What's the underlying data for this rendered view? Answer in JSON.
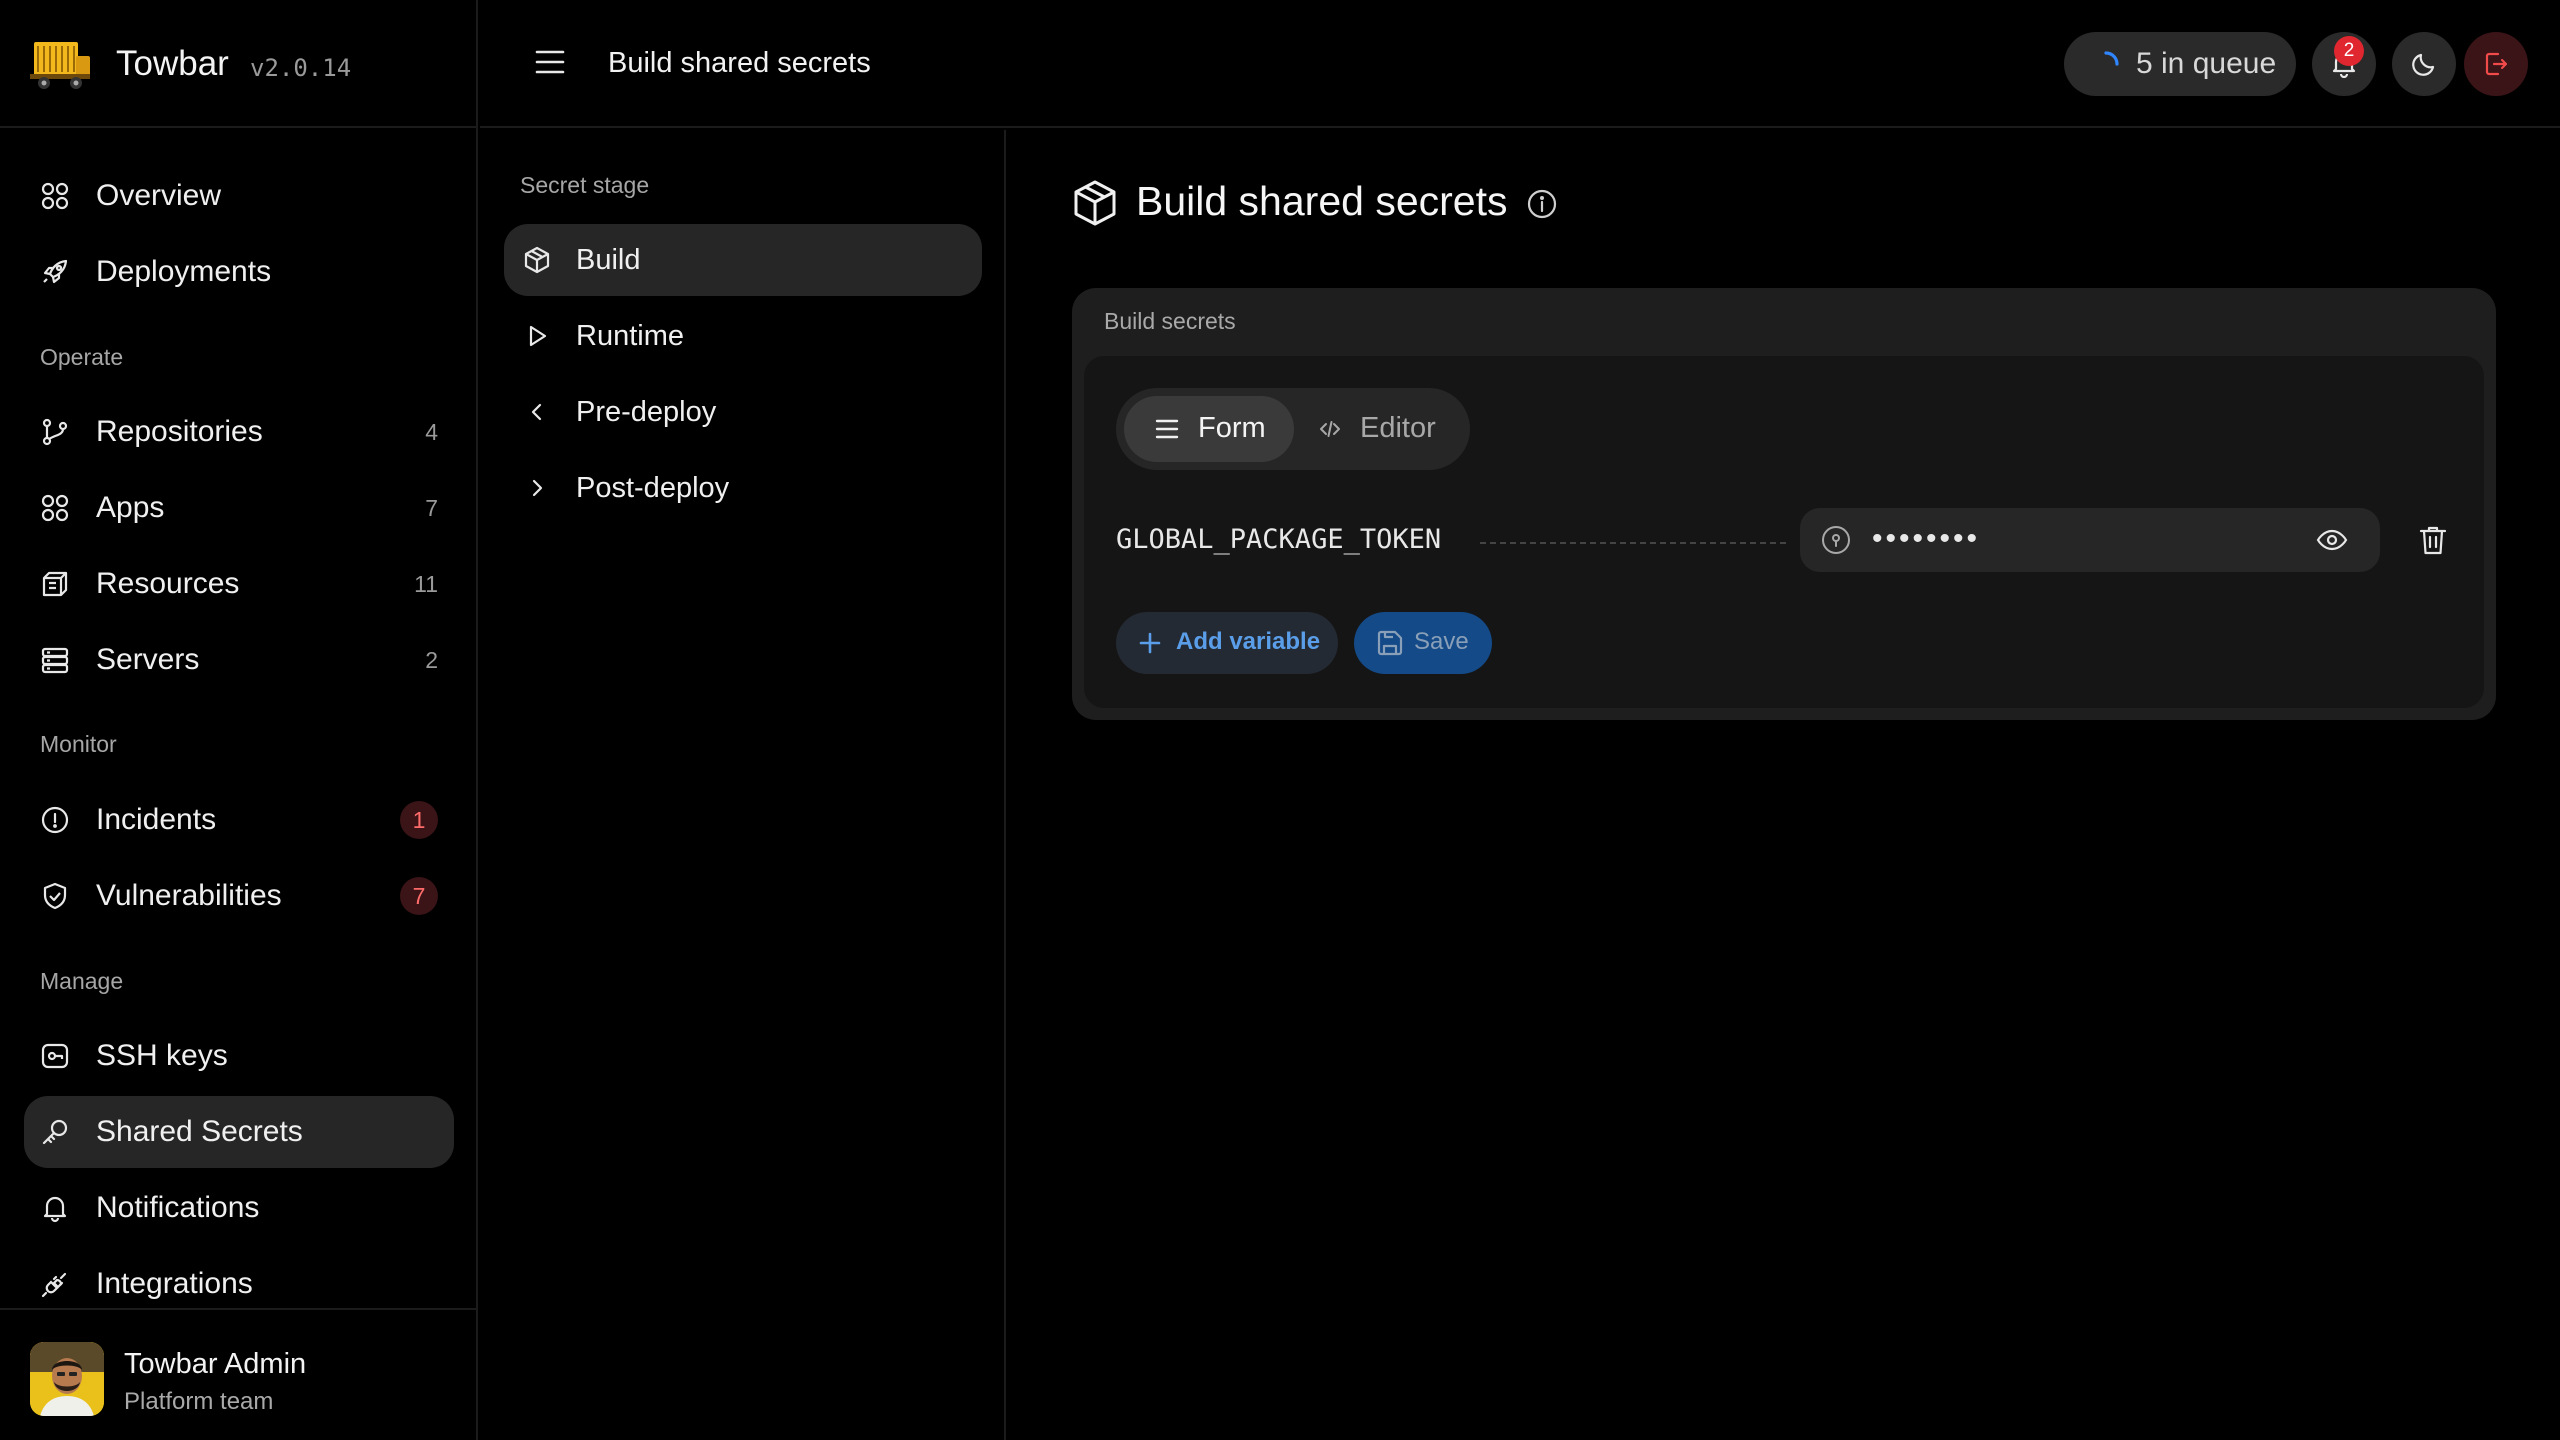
{
  "app": {
    "name": "Towbar",
    "version": "v2.0.14"
  },
  "sidebar": {
    "primary": [
      {
        "label": "Overview",
        "icon": "grid-icon"
      },
      {
        "label": "Deployments",
        "icon": "rocket-icon"
      }
    ],
    "sections": [
      {
        "title": "Operate",
        "items": [
          {
            "label": "Repositories",
            "count": "4",
            "icon": "git-branch-icon"
          },
          {
            "label": "Apps",
            "count": "7",
            "icon": "grid-icon"
          },
          {
            "label": "Resources",
            "count": "11",
            "icon": "database-icon"
          },
          {
            "label": "Servers",
            "count": "2",
            "icon": "server-icon"
          }
        ]
      },
      {
        "title": "Monitor",
        "items": [
          {
            "label": "Incidents",
            "badge": "1",
            "icon": "alert-circle-icon"
          },
          {
            "label": "Vulnerabilities",
            "badge": "7",
            "icon": "shield-check-icon"
          }
        ]
      },
      {
        "title": "Manage",
        "items": [
          {
            "label": "SSH keys",
            "icon": "terminal-icon"
          },
          {
            "label": "Shared Secrets",
            "icon": "key-icon",
            "active": true
          },
          {
            "label": "Notifications",
            "icon": "bell-icon"
          },
          {
            "label": "Integrations",
            "icon": "plug-icon"
          }
        ]
      }
    ]
  },
  "user": {
    "name": "Towbar Admin",
    "team": "Platform team"
  },
  "topbar": {
    "title": "Build shared secrets",
    "queue_label": "5 in queue",
    "notification_count": "2",
    "accent_color": "#1e74d8",
    "danger_color": "#e0262f"
  },
  "stage": {
    "heading": "Secret stage",
    "items": [
      {
        "label": "Build",
        "icon": "package-icon",
        "active": true
      },
      {
        "label": "Runtime",
        "icon": "play-icon"
      },
      {
        "label": "Pre-deploy",
        "icon": "chevron-left-icon"
      },
      {
        "label": "Post-deploy",
        "icon": "chevron-right-icon"
      }
    ]
  },
  "main": {
    "title": "Build shared secrets",
    "card_label": "Build secrets",
    "view_toggle": {
      "form": "Form",
      "editor": "Editor",
      "selected": "Form"
    },
    "variables": [
      {
        "key": "GLOBAL_PACKAGE_TOKEN",
        "masked_value": "••••••••"
      }
    ],
    "add_label": "Add variable",
    "save_label": "Save"
  }
}
